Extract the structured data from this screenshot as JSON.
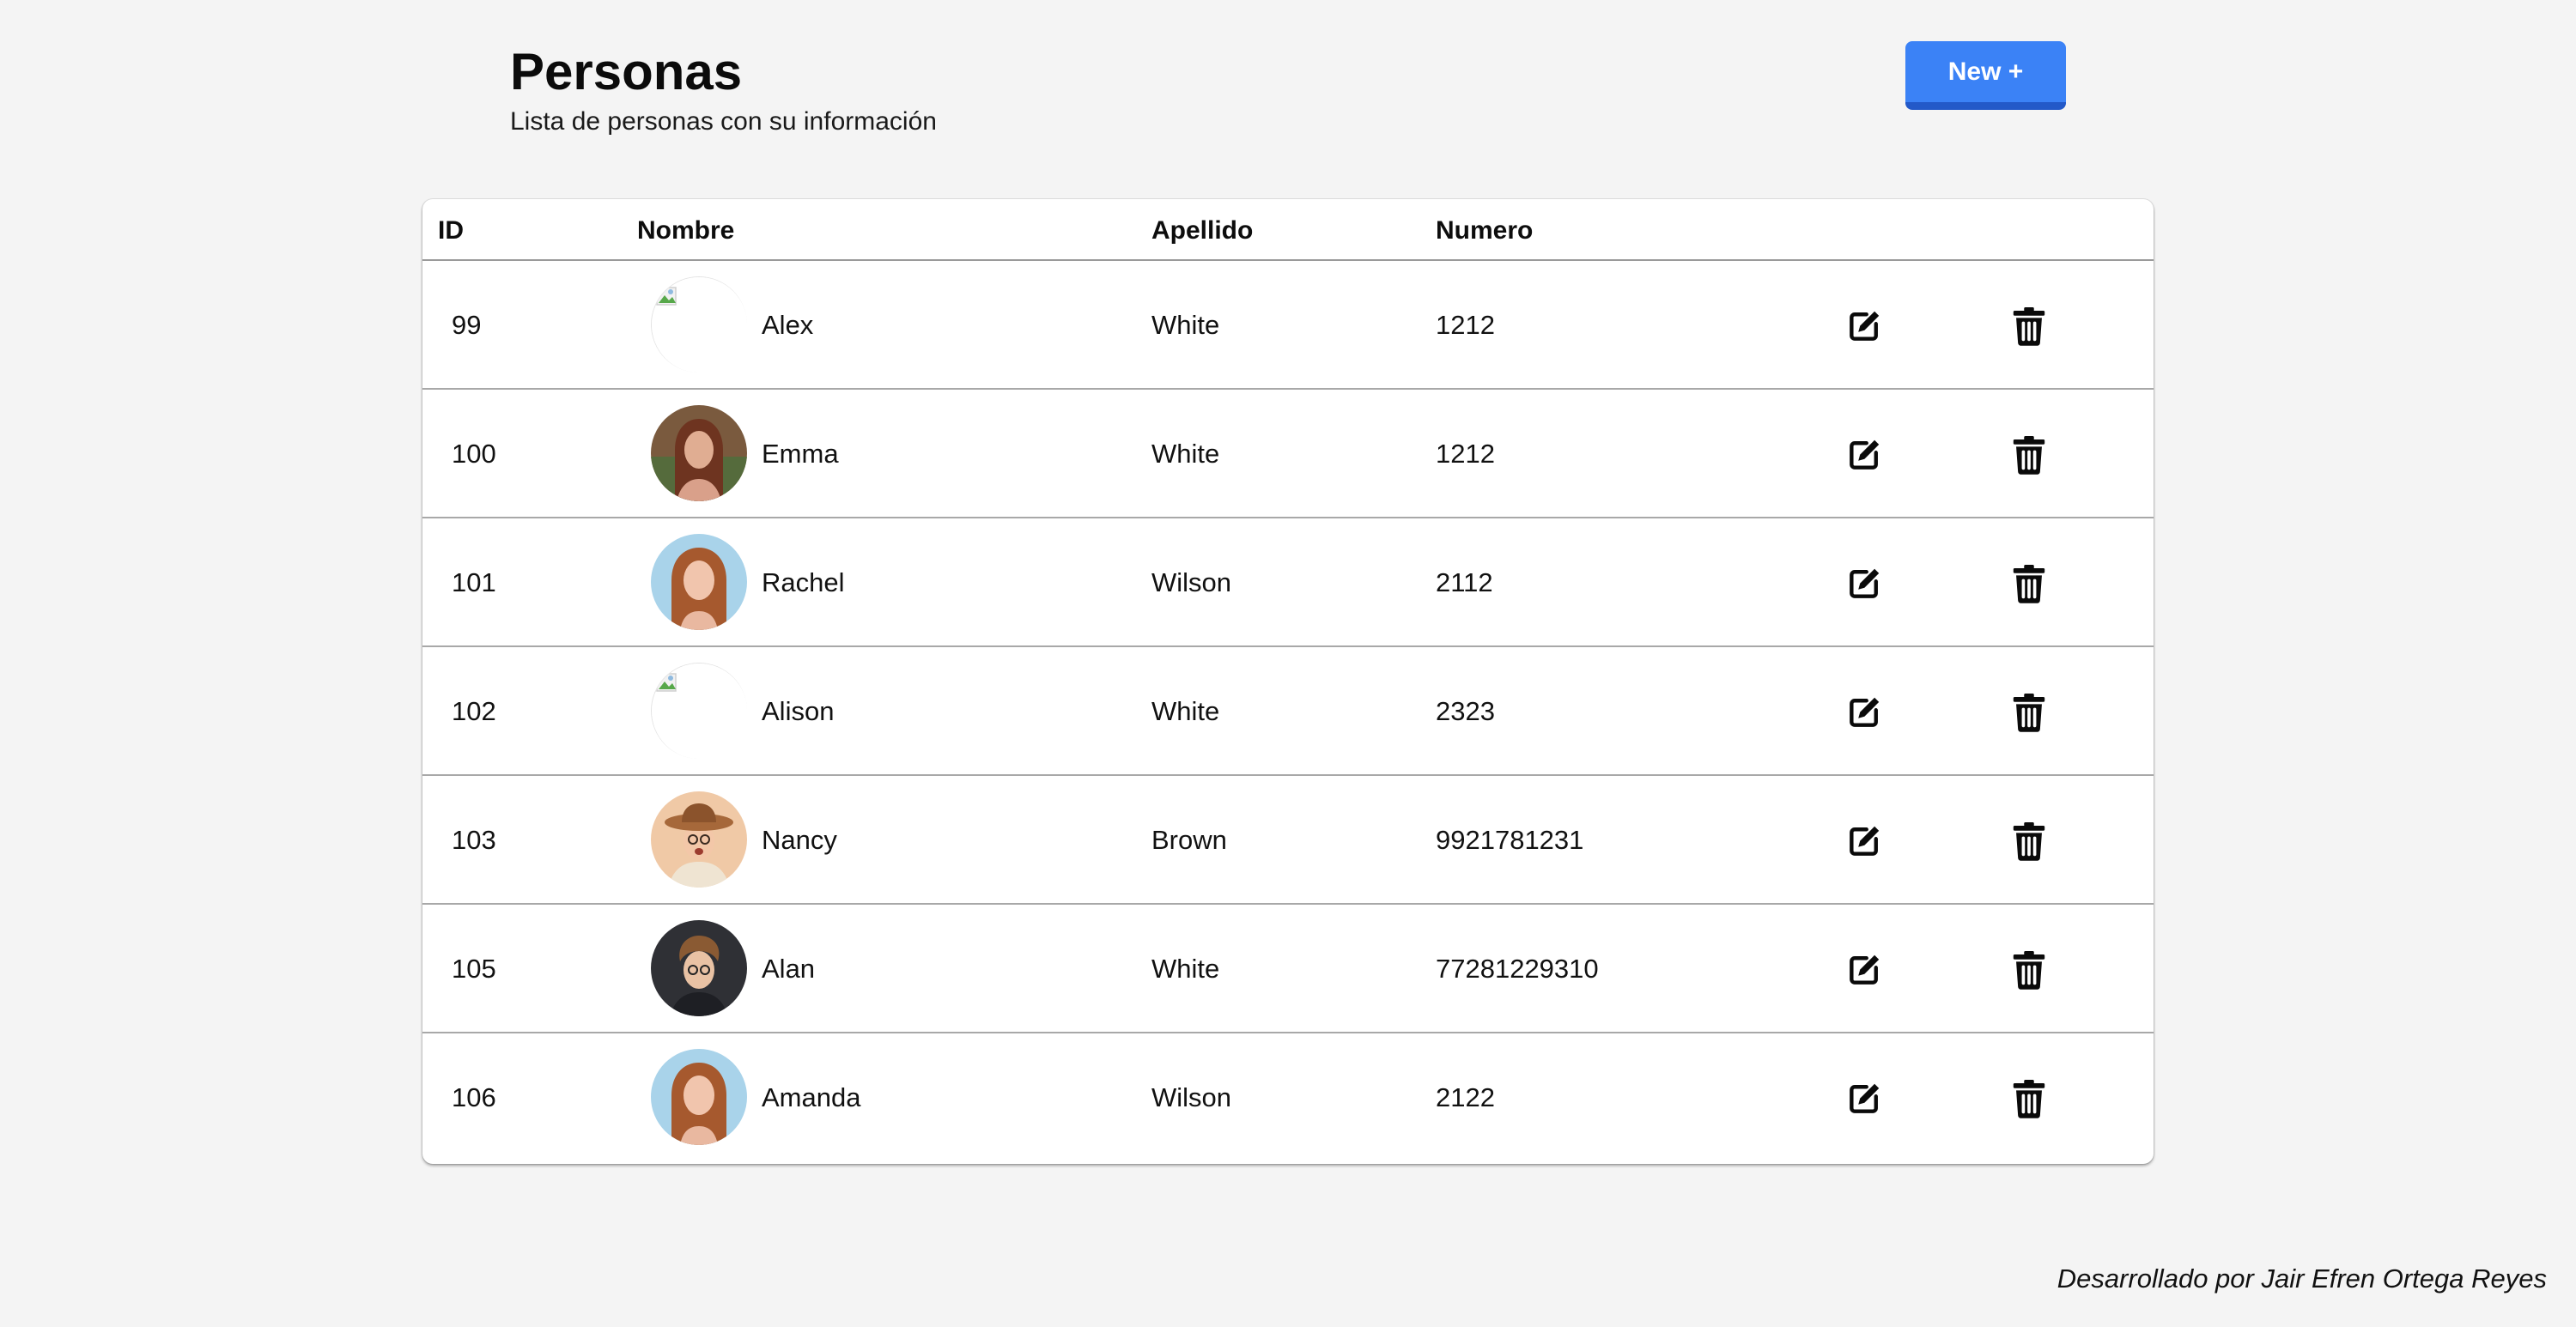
{
  "header": {
    "title": "Personas",
    "subtitle": "Lista de personas con su información",
    "new_button_label": "New +"
  },
  "table": {
    "columns": [
      "ID",
      "Nombre",
      "Apellido",
      "Numero"
    ],
    "rows": [
      {
        "id": "99",
        "nombre": "Alex",
        "apellido": "White",
        "numero": "1212",
        "avatar": "broken-image-icon"
      },
      {
        "id": "100",
        "nombre": "Emma",
        "apellido": "White",
        "numero": "1212",
        "avatar": "portrait-woman-brown-hair"
      },
      {
        "id": "101",
        "nombre": "Rachel",
        "apellido": "Wilson",
        "numero": "2112",
        "avatar": "portrait-woman-red-hair"
      },
      {
        "id": "102",
        "nombre": "Alison",
        "apellido": "White",
        "numero": "2323",
        "avatar": "broken-image-icon"
      },
      {
        "id": "103",
        "nombre": "Nancy",
        "apellido": "Brown",
        "numero": "9921781231",
        "avatar": "portrait-woman-hat"
      },
      {
        "id": "105",
        "nombre": "Alan",
        "apellido": "White",
        "numero": "77281229310",
        "avatar": "portrait-man-curly-hair"
      },
      {
        "id": "106",
        "nombre": "Amanda",
        "apellido": "Wilson",
        "numero": "2122",
        "avatar": "portrait-woman-red-hair"
      }
    ],
    "row_actions": [
      "edit-icon",
      "trash-icon"
    ]
  },
  "footer": {
    "credit": "Desarrollado por Jair Efren Ortega Reyes"
  },
  "colors": {
    "background": "#f4f4f4",
    "accent": "#3b82f6",
    "accent_dark": "#2359c8"
  }
}
